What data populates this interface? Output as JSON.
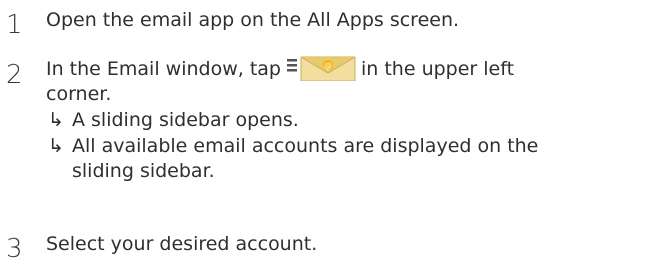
{
  "steps": [
    {
      "number": "1",
      "text": "Open the email app on the All Apps screen."
    },
    {
      "number": "2",
      "text_before": "In the Email window, tap",
      "icon": "menu-email-envelope-icon",
      "text_after": "in the upper left",
      "text_line2": "corner.",
      "results": [
        {
          "arrow": "↳",
          "text": "A sliding sidebar opens."
        },
        {
          "arrow": "↳",
          "text": "All available email accounts are displayed on the",
          "text_line2": "sliding sidebar."
        }
      ]
    },
    {
      "number": "3",
      "text": "Select your desired account."
    }
  ],
  "colors": {
    "text": "#2f2f2f",
    "envelope": "#f2dfa0",
    "envelope_flap": "#e9c96a",
    "envelope_seal": "#f5b400",
    "menu_lines": "#555555"
  }
}
